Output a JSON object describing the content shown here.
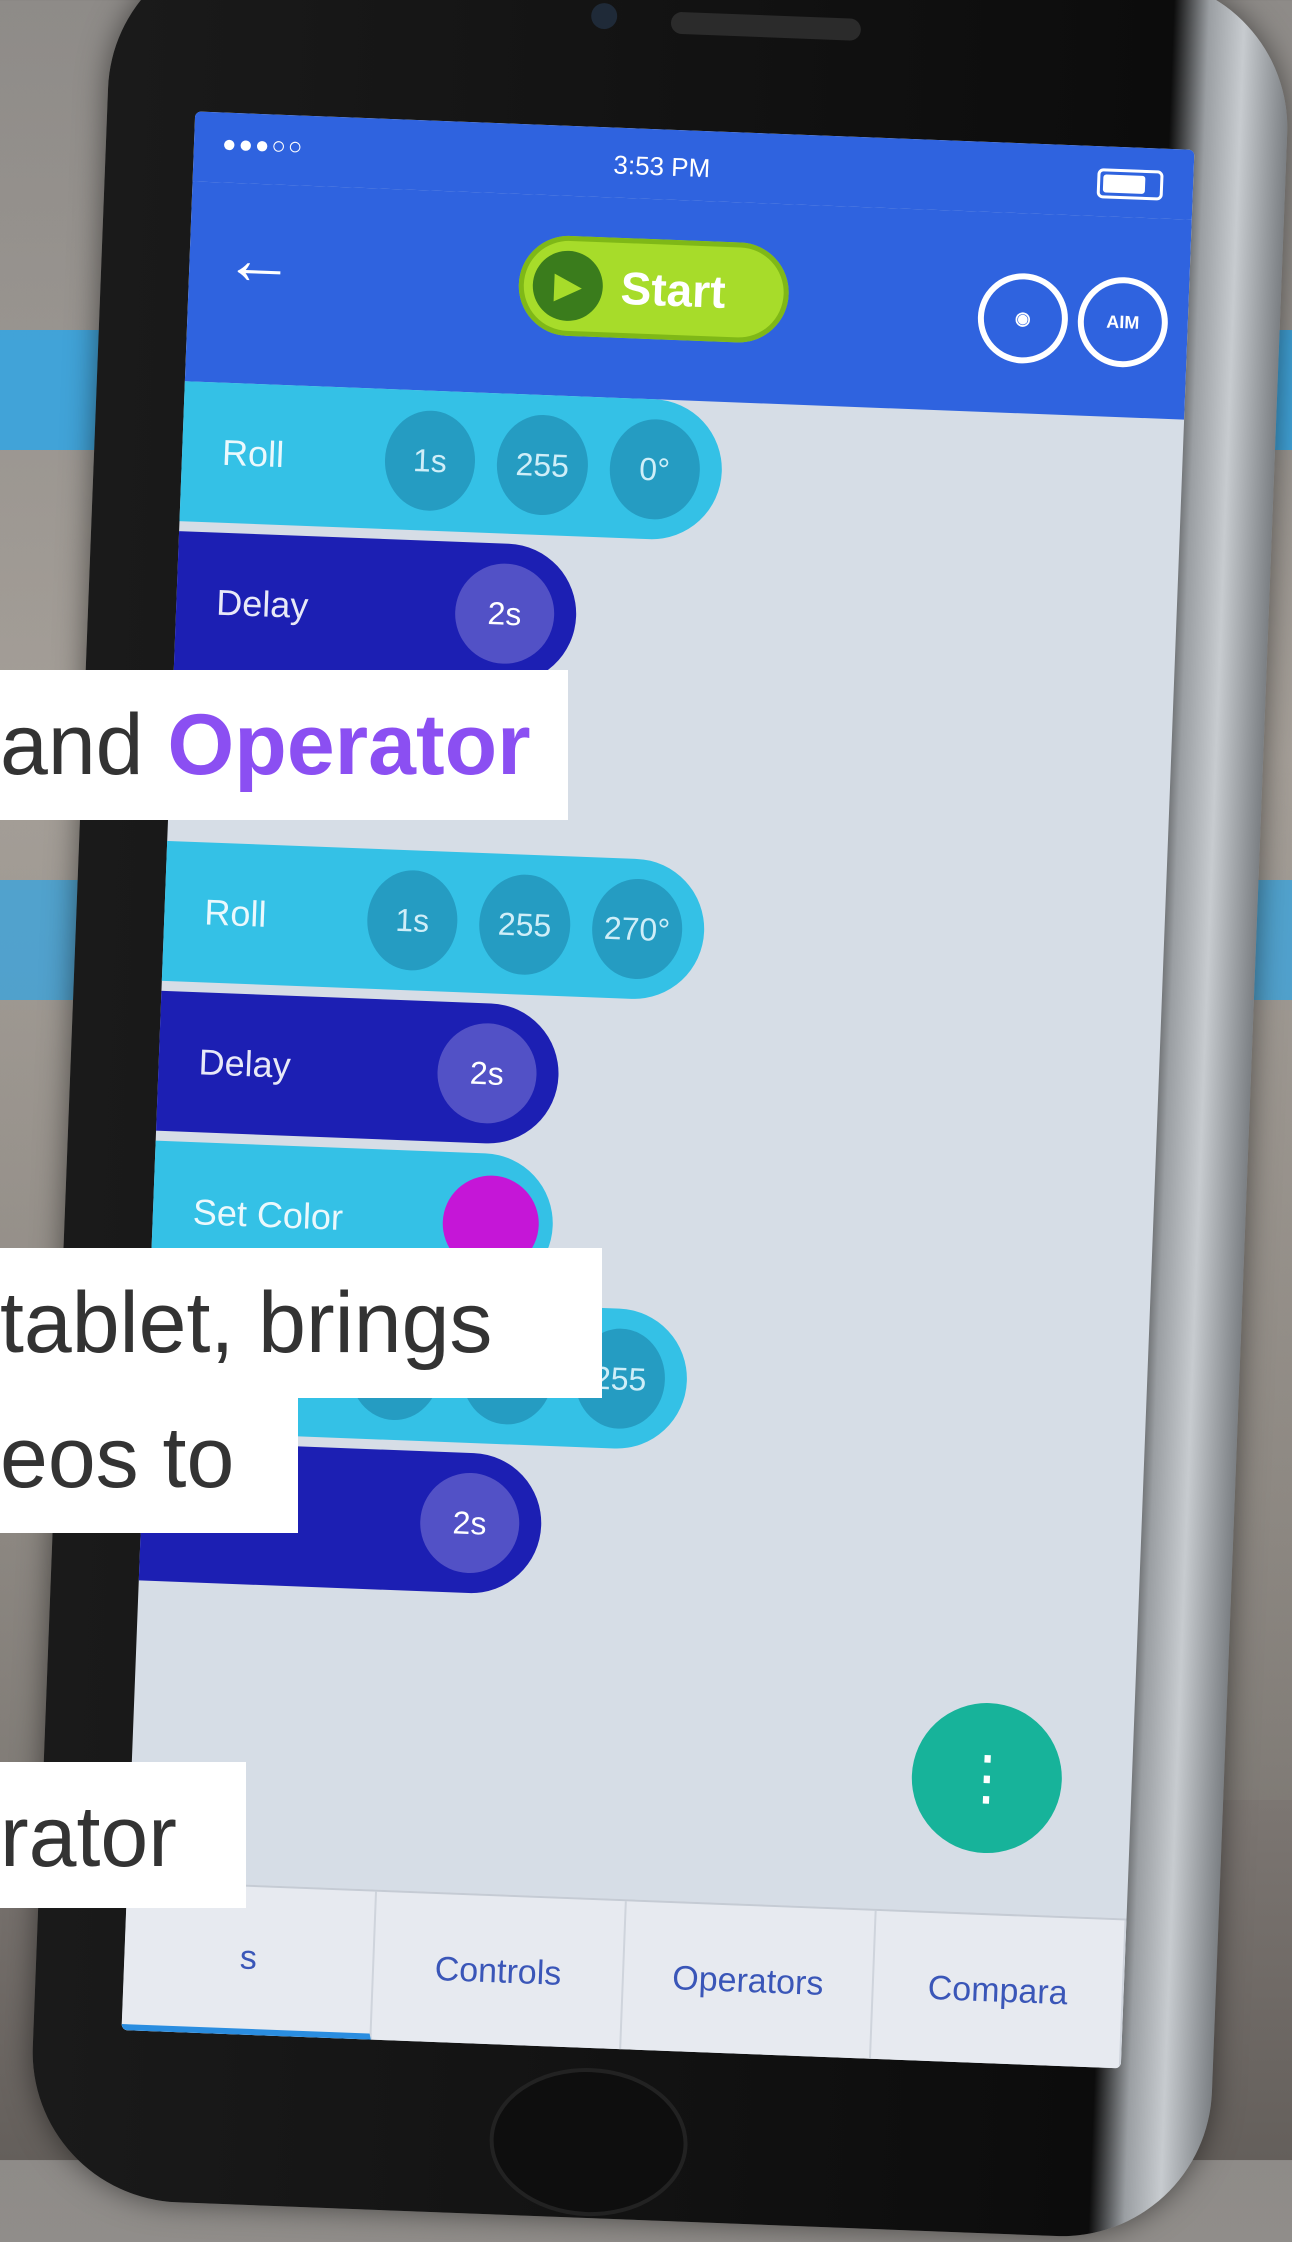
{
  "status": {
    "signal": "●●●○○",
    "time": "3:53 PM"
  },
  "toolbar": {
    "back_icon": "arrow-left-icon",
    "start_label": "Start",
    "start_icon": "play-icon",
    "drive_icon": "steering-wheel-icon",
    "aim_label": "AIM"
  },
  "blocks": [
    {
      "type": "roll",
      "label": "Roll",
      "params": [
        "1s",
        "255",
        "0°"
      ]
    },
    {
      "type": "delay",
      "label": "Delay",
      "params": [
        "2s"
      ]
    },
    {
      "type": "roll",
      "label": "Roll",
      "params": [
        "1s",
        "255",
        "270°"
      ]
    },
    {
      "type": "delay",
      "label": "Delay",
      "params": [
        "2s"
      ]
    },
    {
      "type": "color",
      "label": "Set Color",
      "color": "#c516d7"
    },
    {
      "type": "roll",
      "label": "",
      "params": [
        "",
        "",
        "255"
      ]
    },
    {
      "type": "delay",
      "label": "",
      "params": [
        "2s"
      ]
    }
  ],
  "tabs": [
    "s",
    "Controls",
    "Operators",
    "Compara"
  ],
  "fab_icon": "more-vertical-icon",
  "captions": {
    "line1_prefix": "and ",
    "line1_accent": "Operator",
    "line2": " tablet, brings",
    "line3": "eos to",
    "line4": "rator"
  },
  "colors": {
    "app_blue": "#2f63df",
    "start_green": "#a7dc2a",
    "accent_purple": "#8b4ff2"
  }
}
